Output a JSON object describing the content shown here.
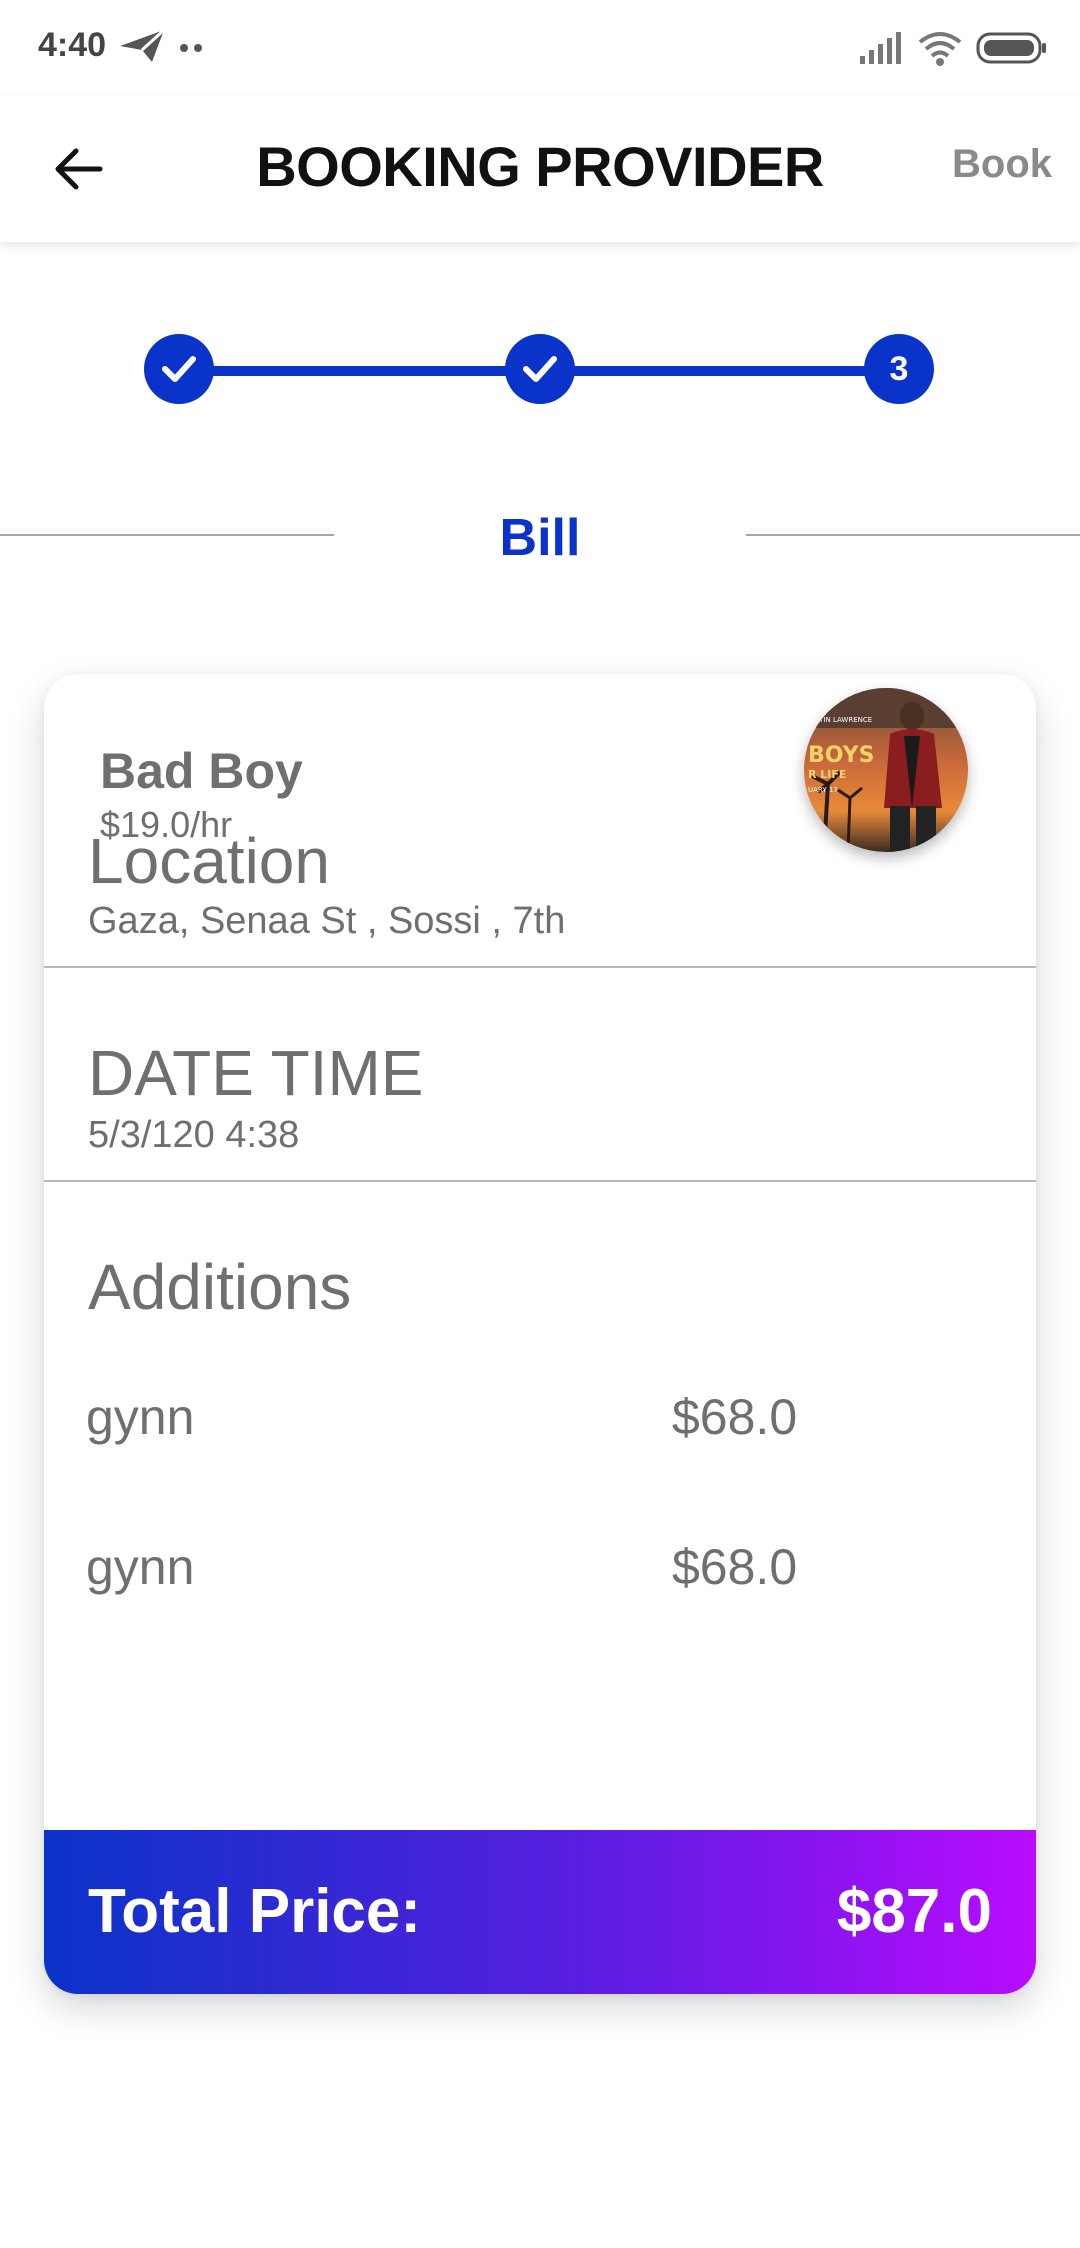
{
  "status_bar": {
    "time": "4:40"
  },
  "app_bar": {
    "title": "BOOKING PROVIDER",
    "action_label": "Book"
  },
  "stepper": {
    "steps": [
      {
        "state": "done"
      },
      {
        "state": "done"
      },
      {
        "state": "current",
        "label": "3"
      }
    ],
    "accent_color": "#0a33c9"
  },
  "section": {
    "title": "Bill"
  },
  "bill": {
    "provider": {
      "name": "Bad Boy",
      "rate": "$19.0/hr"
    },
    "location": {
      "heading": "Location",
      "value": "Gaza, Senaa St , Sossi , 7th"
    },
    "date_time": {
      "heading": "DATE TIME",
      "value": "5/3/120 4:38"
    },
    "additions": {
      "heading": "Additions",
      "items": [
        {
          "name": "gynn",
          "price": "$68.0"
        },
        {
          "name": "gynn",
          "price": "$68.0"
        }
      ]
    },
    "total": {
      "label": "Total Price:",
      "value": "$87.0"
    }
  },
  "colors": {
    "accent": "#0a33c9",
    "gradient_start": "#0a33c9",
    "gradient_end": "#b90bff",
    "muted_text": "#6f6f6f"
  }
}
